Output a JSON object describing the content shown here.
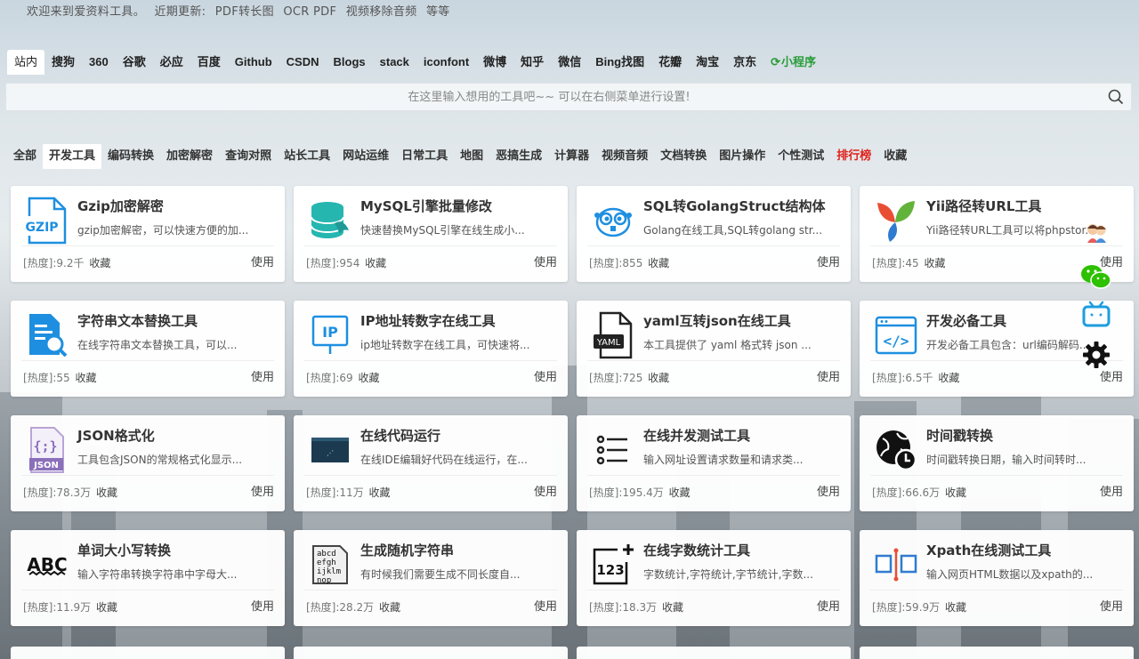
{
  "welcome": {
    "prefix": "欢迎来到爱资料工具。",
    "recent_label": "近期更新:",
    "updates": [
      "PDF转长图",
      "OCR PDF",
      "视频移除音频",
      "等等"
    ]
  },
  "engines": [
    "站内",
    "搜狗",
    "360",
    "谷歌",
    "必应",
    "百度",
    "Github",
    "CSDN",
    "Blogs",
    "stack",
    "iconfont",
    "微博",
    "知乎",
    "微信",
    "Bing找图",
    "花瓣",
    "淘宝",
    "京东",
    "小程序"
  ],
  "engine_active": "站内",
  "search": {
    "placeholder": "在这里输入想用的工具吧~~ 可以在右侧菜单进行设置!"
  },
  "categories": [
    "全部",
    "开发工具",
    "编码转换",
    "加密解密",
    "查询对照",
    "站长工具",
    "网站运维",
    "日常工具",
    "地图",
    "恶搞生成",
    "计算器",
    "视频音频",
    "文档转换",
    "图片操作",
    "个性测试",
    "排行榜",
    "收藏"
  ],
  "category_active": "开发工具",
  "category_hot": "排行榜",
  "card_common": {
    "fav": "收藏",
    "use": "使用",
    "heat_prefix": "[热度]:"
  },
  "cards": [
    {
      "icon": "gzip-icon",
      "title": "Gzip加密解密",
      "desc": "gzip加密解密，可以快速方便的加...",
      "heat": "9.2千"
    },
    {
      "icon": "mysql-icon",
      "title": "MySQL引擎批量修改",
      "desc": "快速替换MySQL引擎在线生成小...",
      "heat": "954"
    },
    {
      "icon": "golang-icon",
      "title": "SQL转GolangStruct结构体",
      "desc": "Golang在线工具,SQL转golang str...",
      "heat": "855"
    },
    {
      "icon": "yii-icon",
      "title": "Yii路径转URL工具",
      "desc": "Yii路径转URL工具可以将phpstor...",
      "heat": "45"
    },
    {
      "icon": "text-replace-icon",
      "title": "字符串文本替换工具",
      "desc": "在线字符串文本替换工具，可以...",
      "heat": "55"
    },
    {
      "icon": "ip-icon",
      "title": "IP地址转数字在线工具",
      "desc": "ip地址转数字在线工具，可快速将...",
      "heat": "69"
    },
    {
      "icon": "yaml-icon",
      "title": "yaml互转json在线工具",
      "desc": "本工具提供了 yaml 格式转 json ...",
      "heat": "725"
    },
    {
      "icon": "code-window-icon",
      "title": "开发必备工具",
      "desc": "开发必备工具包含：url编码解码...",
      "heat": "6.5千"
    },
    {
      "icon": "json-icon",
      "title": "JSON格式化",
      "desc": "工具包含JSON的常规格式化显示...",
      "heat": "78.3万"
    },
    {
      "icon": "ide-icon",
      "title": "在线代码运行",
      "desc": "在线IDE编辑好代码在线运行，在...",
      "heat": "11万"
    },
    {
      "icon": "list-icon",
      "title": "在线并发测试工具",
      "desc": "输入网址设置请求数量和请求类...",
      "heat": "195.4万"
    },
    {
      "icon": "globe-clock-icon",
      "title": "时间戳转换",
      "desc": "时间戳转换日期，输入时间转时...",
      "heat": "66.6万"
    },
    {
      "icon": "abc-icon",
      "title": "单词大小写转换",
      "desc": "输入字符串转换字符串中字母大...",
      "heat": "11.9万"
    },
    {
      "icon": "random-string-icon",
      "title": "生成随机字符串",
      "desc": "有时候我们需要生成不同长度自...",
      "heat": "28.2万"
    },
    {
      "icon": "count-123-icon",
      "title": "在线字数统计工具",
      "desc": "字数统计,字符统计,字节统计,字数...",
      "heat": "18.3万"
    },
    {
      "icon": "xpath-icon",
      "title": "Xpath在线测试工具",
      "desc": "输入网页HTML数据以及xpath的...",
      "heat": "59.9万"
    }
  ],
  "sidebar": [
    "contact-icon",
    "wechat-icon",
    "bilibili-icon",
    "settings-gear-icon"
  ]
}
